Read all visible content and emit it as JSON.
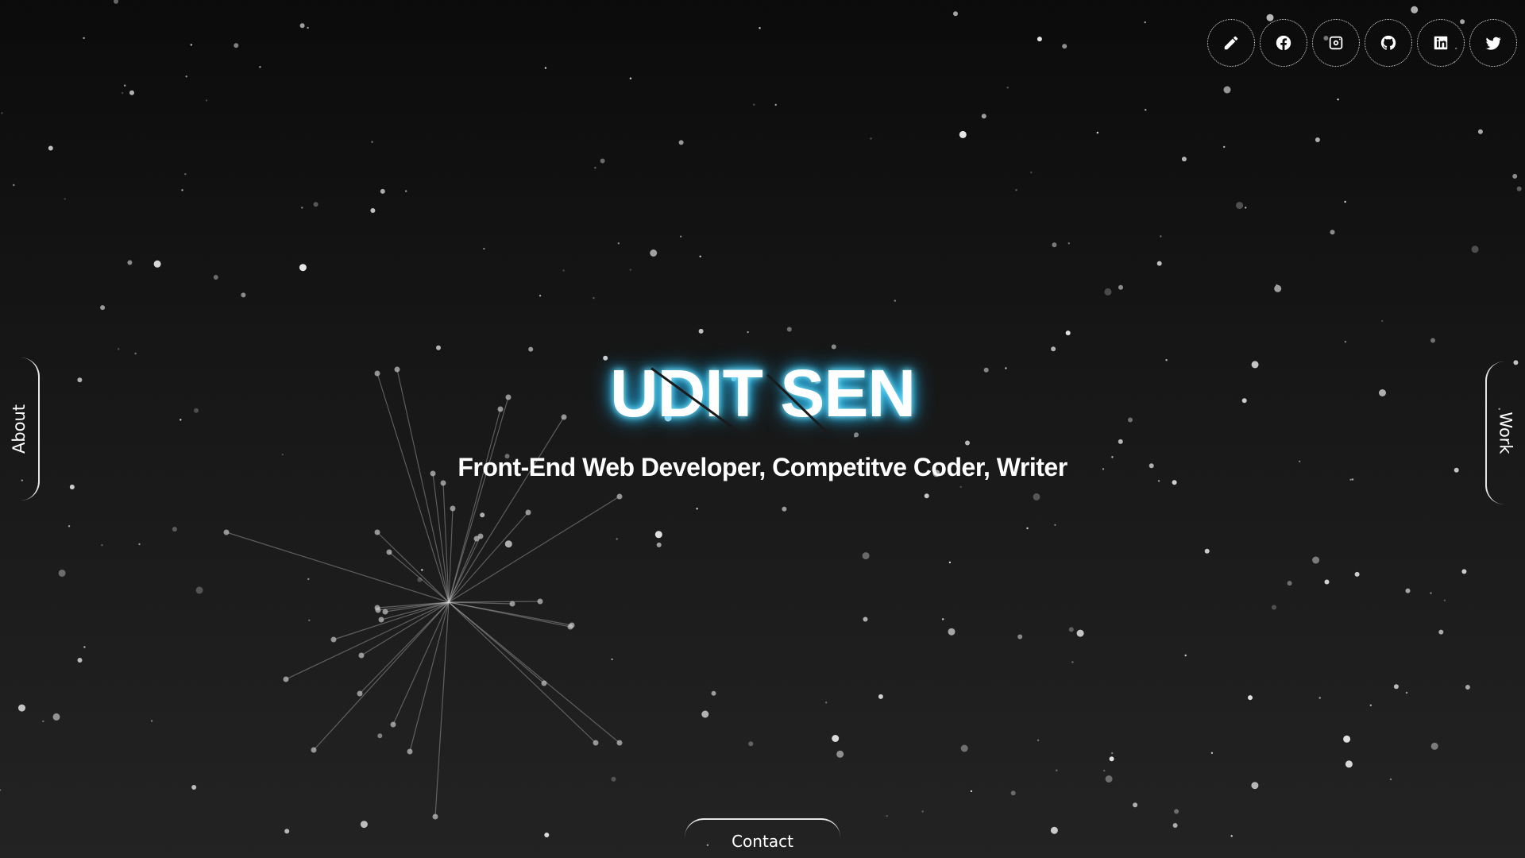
{
  "hero": {
    "name": "UDIT SEN",
    "tagline": "Front-End Web Developer, Competitve Coder, Writer"
  },
  "nav": {
    "left_tab": "About",
    "right_tab": "Work",
    "bottom_tab": "Contact"
  },
  "social_links": [
    {
      "icon": "pencil-icon",
      "label": "Blog"
    },
    {
      "icon": "facebook-icon",
      "label": "Facebook"
    },
    {
      "icon": "instagram-icon",
      "label": "Instagram"
    },
    {
      "icon": "github-icon",
      "label": "GitHub"
    },
    {
      "icon": "linkedin-icon",
      "label": "LinkedIn"
    },
    {
      "icon": "twitter-icon",
      "label": "Twitter"
    }
  ],
  "colors": {
    "background_top": "#0b0b0b",
    "background_bottom": "#232323",
    "title_glow": "#33cfff",
    "text": "#ffffff"
  }
}
